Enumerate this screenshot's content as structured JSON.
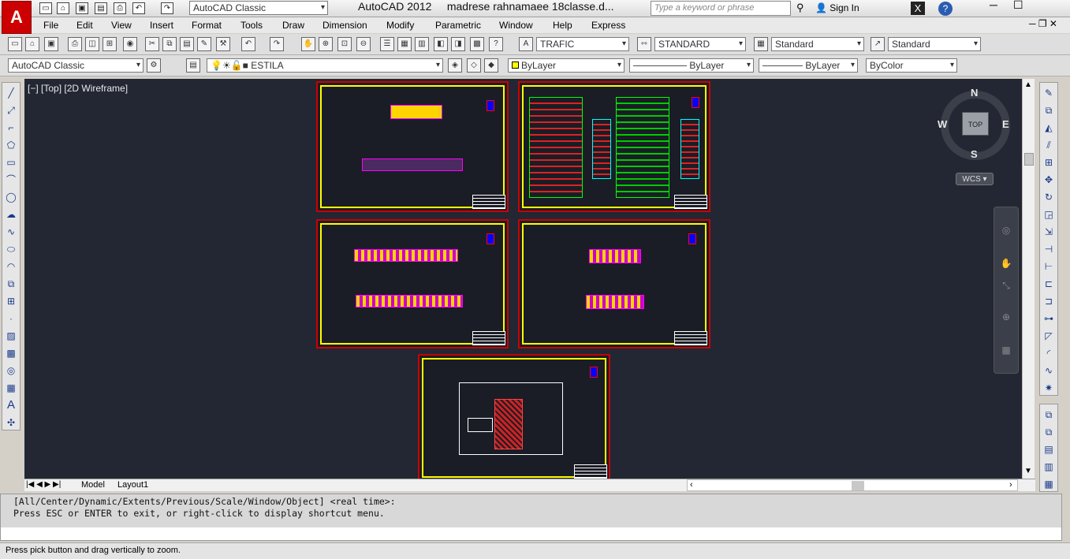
{
  "window": {
    "app_title": "AutoCAD 2012",
    "file_title": "madrese rahnamaee 18classe.d...",
    "workspace_quick": "AutoCAD Classic",
    "search_placeholder": "Type a keyword or phrase",
    "sign_in": "Sign In"
  },
  "menu": [
    "File",
    "Edit",
    "View",
    "Insert",
    "Format",
    "Tools",
    "Draw",
    "Dimension",
    "Modify",
    "Parametric",
    "Window",
    "Help",
    "Express"
  ],
  "styles_toolbar": {
    "text_style": "TRAFIC",
    "dim_style": "STANDARD",
    "table_style": "Standard",
    "mleader_style": "Standard"
  },
  "layers_toolbar": {
    "workspace": "AutoCAD Classic",
    "current_layer": "ESTILA",
    "color": "ByLayer",
    "linetype": "ByLayer",
    "lineweight": "ByLayer",
    "plotstyle": "ByColor"
  },
  "viewport": {
    "label": "[−] [Top] [2D Wireframe]",
    "viewcube_top": "TOP",
    "north": "N",
    "south": "S",
    "east": "E",
    "west": "W",
    "wcs": "WCS"
  },
  "tabs": [
    "Model",
    "Layout1"
  ],
  "command_line": {
    "history_1": "[All/Center/Dynamic/Extents/Previous/Scale/Window/Object] <real time>:",
    "history_2": "Press ESC or ENTER to exit, or right-click to display shortcut menu."
  },
  "status_bar": "Press pick button and drag vertically to zoom.",
  "colors": {
    "canvas": "#222733",
    "sheet_border": "#cc0000",
    "sheet_inner": "#ffff00"
  }
}
